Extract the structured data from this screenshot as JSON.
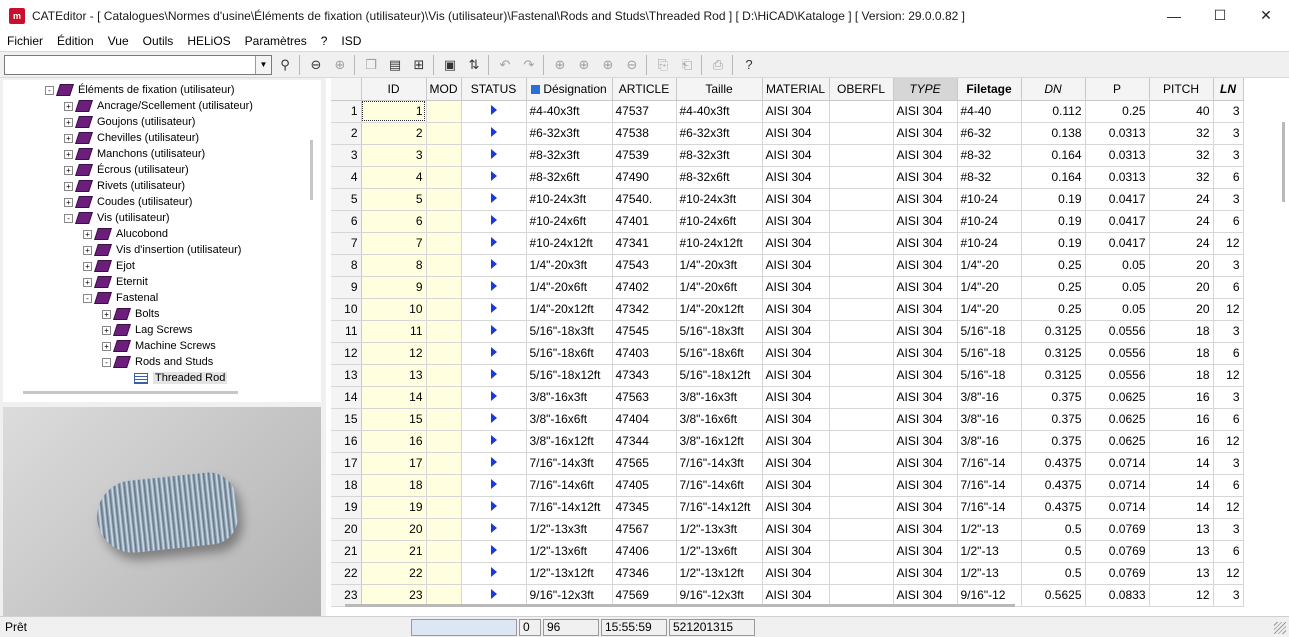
{
  "window": {
    "title": "CATEditor - [ Catalogues\\Normes d'usine\\Éléments de fixation (utilisateur)\\Vis (utilisateur)\\Fastenal\\Rods and Studs\\Threaded Rod ]     [ D:\\HiCAD\\Kataloge ]   [ Version: 29.0.0.82 ]",
    "app_icon_text": "m",
    "minimize": "—",
    "maximize": "☐",
    "close": "✕"
  },
  "menu": [
    "Fichier",
    "Édition",
    "Vue",
    "Outils",
    "HELiOS",
    "Paramètres",
    "?",
    "ISD"
  ],
  "toolbar": {
    "search_value": "",
    "select_arrow": "▼",
    "icons": [
      {
        "name": "binoculars-icon",
        "glyph": "⚲",
        "enabled": true
      },
      {
        "name": "back-icon",
        "glyph": "⊖",
        "enabled": true
      },
      {
        "name": "forward-icon",
        "glyph": "⊕",
        "enabled": false
      },
      {
        "name": "copy-icon",
        "glyph": "❐",
        "enabled": false
      },
      {
        "name": "document-icon",
        "glyph": "▤",
        "enabled": true
      },
      {
        "name": "table-link-icon",
        "glyph": "⊞",
        "enabled": true
      },
      {
        "name": "save-icon",
        "glyph": "▣",
        "enabled": true
      },
      {
        "name": "sort-icon",
        "glyph": "⇅",
        "enabled": true
      },
      {
        "name": "undo-icon",
        "glyph": "↶",
        "enabled": false
      },
      {
        "name": "redo-icon",
        "glyph": "↷",
        "enabled": false
      },
      {
        "name": "insert-row-icon",
        "glyph": "⊕",
        "enabled": false
      },
      {
        "name": "insert-column-icon",
        "glyph": "⊕",
        "enabled": false
      },
      {
        "name": "append-icon",
        "glyph": "⊕",
        "enabled": false
      },
      {
        "name": "delete-icon",
        "glyph": "⊖",
        "enabled": false
      },
      {
        "name": "clipboard-copy-icon",
        "glyph": "⎘",
        "enabled": false
      },
      {
        "name": "paste-icon",
        "glyph": "⎗",
        "enabled": false
      },
      {
        "name": "print-icon",
        "glyph": "⎙",
        "enabled": false
      },
      {
        "name": "help-icon",
        "glyph": "?",
        "enabled": true
      }
    ]
  },
  "tree": [
    {
      "label": "Éléments de fixation (utilisateur)",
      "level": 0,
      "expander": "-"
    },
    {
      "label": "Ancrage/Scellement (utilisateur)",
      "level": 1,
      "expander": "+"
    },
    {
      "label": "Goujons (utilisateur)",
      "level": 1,
      "expander": "+"
    },
    {
      "label": "Chevilles (utilisateur)",
      "level": 1,
      "expander": "+"
    },
    {
      "label": "Manchons (utilisateur)",
      "level": 1,
      "expander": "+"
    },
    {
      "label": "Écrous (utilisateur)",
      "level": 1,
      "expander": "+"
    },
    {
      "label": "Rivets (utilisateur)",
      "level": 1,
      "expander": "+"
    },
    {
      "label": "Coudes (utilisateur)",
      "level": 1,
      "expander": "+"
    },
    {
      "label": "Vis (utilisateur)",
      "level": 1,
      "expander": "-"
    },
    {
      "label": "Alucobond",
      "level": 2,
      "expander": "+"
    },
    {
      "label": "Vis d'insertion (utilisateur)",
      "level": 2,
      "expander": "+"
    },
    {
      "label": "Ejot",
      "level": 2,
      "expander": "+"
    },
    {
      "label": "Eternit",
      "level": 2,
      "expander": "+"
    },
    {
      "label": "Fastenal",
      "level": 2,
      "expander": "-"
    },
    {
      "label": "Bolts",
      "level": 3,
      "expander": "+"
    },
    {
      "label": "Lag Screws",
      "level": 3,
      "expander": "+"
    },
    {
      "label": "Machine Screws",
      "level": 3,
      "expander": "+"
    },
    {
      "label": "Rods and Studs",
      "level": 3,
      "expander": "-"
    },
    {
      "label": "Threaded Rod",
      "level": 4,
      "expander": "",
      "leaf": true
    }
  ],
  "columns": [
    {
      "label": "",
      "style": ""
    },
    {
      "label": "ID",
      "style": ""
    },
    {
      "label": "MOD",
      "style": ""
    },
    {
      "label": "STATUS",
      "style": ""
    },
    {
      "label": "Désignation",
      "style": ""
    },
    {
      "label": "ARTICLE",
      "style": ""
    },
    {
      "label": "Taille",
      "style": ""
    },
    {
      "label": "MATERIAL",
      "style": ""
    },
    {
      "label": "OBERFL",
      "style": ""
    },
    {
      "label": "TYPE",
      "style": "italic dark"
    },
    {
      "label": "Filetage",
      "style": "bold"
    },
    {
      "label": "DN",
      "style": "italic"
    },
    {
      "label": "P",
      "style": ""
    },
    {
      "label": "PITCH",
      "style": ""
    },
    {
      "label": "LN",
      "style": "italic bold"
    }
  ],
  "rows": [
    [
      "1",
      "1",
      "",
      "#4-40x3ft",
      "47537",
      "#4-40x3ft",
      "AISI 304",
      "",
      "AISI 304",
      "#4-40",
      "0.112",
      "0.25",
      "40",
      "3"
    ],
    [
      "2",
      "2",
      "",
      "#6-32x3ft",
      "47538",
      "#6-32x3ft",
      "AISI 304",
      "",
      "AISI 304",
      "#6-32",
      "0.138",
      "0.0313",
      "32",
      "3"
    ],
    [
      "3",
      "3",
      "",
      "#8-32x3ft",
      "47539",
      "#8-32x3ft",
      "AISI 304",
      "",
      "AISI 304",
      "#8-32",
      "0.164",
      "0.0313",
      "32",
      "3"
    ],
    [
      "4",
      "4",
      "",
      "#8-32x6ft",
      "47490",
      "#8-32x6ft",
      "AISI 304",
      "",
      "AISI 304",
      "#8-32",
      "0.164",
      "0.0313",
      "32",
      "6"
    ],
    [
      "5",
      "5",
      "",
      "#10-24x3ft",
      "47540.",
      "#10-24x3ft",
      "AISI 304",
      "",
      "AISI 304",
      "#10-24",
      "0.19",
      "0.0417",
      "24",
      "3"
    ],
    [
      "6",
      "6",
      "",
      "#10-24x6ft",
      "47401",
      "#10-24x6ft",
      "AISI 304",
      "",
      "AISI 304",
      "#10-24",
      "0.19",
      "0.0417",
      "24",
      "6"
    ],
    [
      "7",
      "7",
      "",
      "#10-24x12ft",
      "47341",
      "#10-24x12ft",
      "AISI 304",
      "",
      "AISI 304",
      "#10-24",
      "0.19",
      "0.0417",
      "24",
      "12"
    ],
    [
      "8",
      "8",
      "",
      "1/4\"-20x3ft",
      "47543",
      "1/4\"-20x3ft",
      "AISI 304",
      "",
      "AISI 304",
      "1/4\"-20",
      "0.25",
      "0.05",
      "20",
      "3"
    ],
    [
      "9",
      "9",
      "",
      "1/4\"-20x6ft",
      "47402",
      "1/4\"-20x6ft",
      "AISI 304",
      "",
      "AISI 304",
      "1/4\"-20",
      "0.25",
      "0.05",
      "20",
      "6"
    ],
    [
      "10",
      "10",
      "",
      "1/4\"-20x12ft",
      "47342",
      "1/4\"-20x12ft",
      "AISI 304",
      "",
      "AISI 304",
      "1/4\"-20",
      "0.25",
      "0.05",
      "20",
      "12"
    ],
    [
      "11",
      "11",
      "",
      "5/16\"-18x3ft",
      "47545",
      "5/16\"-18x3ft",
      "AISI 304",
      "",
      "AISI 304",
      "5/16\"-18",
      "0.3125",
      "0.0556",
      "18",
      "3"
    ],
    [
      "12",
      "12",
      "",
      "5/16\"-18x6ft",
      "47403",
      "5/16\"-18x6ft",
      "AISI 304",
      "",
      "AISI 304",
      "5/16\"-18",
      "0.3125",
      "0.0556",
      "18",
      "6"
    ],
    [
      "13",
      "13",
      "",
      "5/16\"-18x12ft",
      "47343",
      "5/16\"-18x12ft",
      "AISI 304",
      "",
      "AISI 304",
      "5/16\"-18",
      "0.3125",
      "0.0556",
      "18",
      "12"
    ],
    [
      "14",
      "14",
      "",
      "3/8\"-16x3ft",
      "47563",
      "3/8\"-16x3ft",
      "AISI 304",
      "",
      "AISI 304",
      "3/8\"-16",
      "0.375",
      "0.0625",
      "16",
      "3"
    ],
    [
      "15",
      "15",
      "",
      "3/8\"-16x6ft",
      "47404",
      "3/8\"-16x6ft",
      "AISI 304",
      "",
      "AISI 304",
      "3/8\"-16",
      "0.375",
      "0.0625",
      "16",
      "6"
    ],
    [
      "16",
      "16",
      "",
      "3/8\"-16x12ft",
      "47344",
      "3/8\"-16x12ft",
      "AISI 304",
      "",
      "AISI 304",
      "3/8\"-16",
      "0.375",
      "0.0625",
      "16",
      "12"
    ],
    [
      "17",
      "17",
      "",
      "7/16\"-14x3ft",
      "47565",
      "7/16\"-14x3ft",
      "AISI 304",
      "",
      "AISI 304",
      "7/16\"-14",
      "0.4375",
      "0.0714",
      "14",
      "3"
    ],
    [
      "18",
      "18",
      "",
      "7/16\"-14x6ft",
      "47405",
      "7/16\"-14x6ft",
      "AISI 304",
      "",
      "AISI 304",
      "7/16\"-14",
      "0.4375",
      "0.0714",
      "14",
      "6"
    ],
    [
      "19",
      "19",
      "",
      "7/16\"-14x12ft",
      "47345",
      "7/16\"-14x12ft",
      "AISI 304",
      "",
      "AISI 304",
      "7/16\"-14",
      "0.4375",
      "0.0714",
      "14",
      "12"
    ],
    [
      "20",
      "20",
      "",
      "1/2\"-13x3ft",
      "47567",
      "1/2\"-13x3ft",
      "AISI 304",
      "",
      "AISI 304",
      "1/2\"-13",
      "0.5",
      "0.0769",
      "13",
      "3"
    ],
    [
      "21",
      "21",
      "",
      "1/2\"-13x6ft",
      "47406",
      "1/2\"-13x6ft",
      "AISI 304",
      "",
      "AISI 304",
      "1/2\"-13",
      "0.5",
      "0.0769",
      "13",
      "6"
    ],
    [
      "22",
      "22",
      "",
      "1/2\"-13x12ft",
      "47346",
      "1/2\"-13x12ft",
      "AISI 304",
      "",
      "AISI 304",
      "1/2\"-13",
      "0.5",
      "0.0769",
      "13",
      "12"
    ],
    [
      "23",
      "23",
      "",
      "9/16\"-12x3ft",
      "47569",
      "9/16\"-12x3ft",
      "AISI 304",
      "",
      "AISI 304",
      "9/16\"-12",
      "0.5625",
      "0.0833",
      "12",
      "3"
    ]
  ],
  "statusbar": {
    "text": "Prêt",
    "cells": [
      "",
      "0",
      "96",
      "15:55:59",
      "521201315"
    ]
  },
  "colors": {
    "id_column_bg": "#ffffe0",
    "status_arrow": "#1a3adb",
    "tree_book": "#6b1f7a",
    "app_icon": "#c8102e"
  }
}
